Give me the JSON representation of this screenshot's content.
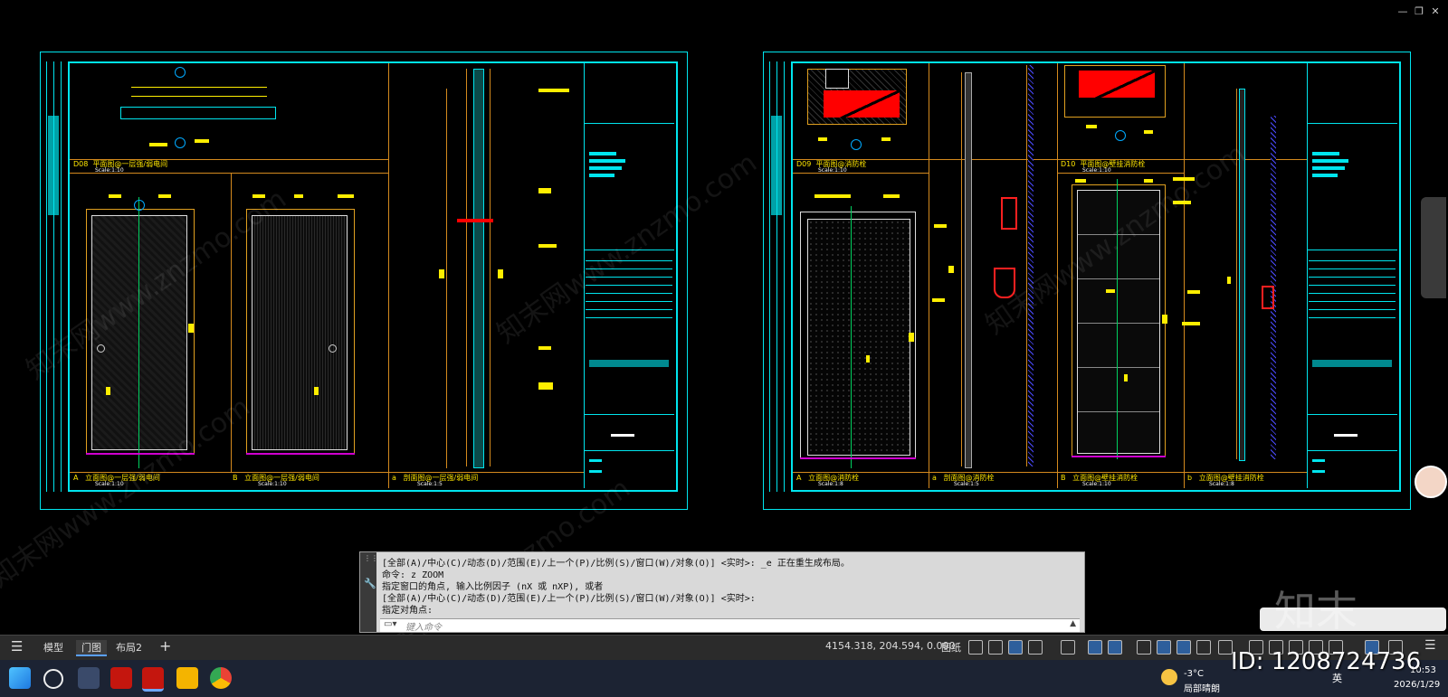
{
  "window": {
    "minimize_icon": "minimize-icon",
    "restore_icon": "restore-icon",
    "close_icon": "close-icon"
  },
  "sheet_left": {
    "views": [
      {
        "code": "D08",
        "title": "平面图@一层强/弱电间",
        "scale": "Scale:1:10"
      },
      {
        "code": "A",
        "title": "立面图@一层强/弱电间",
        "scale": "Scale:1:10"
      },
      {
        "code": "B",
        "title": "立面图@一层强/弱电间",
        "scale": "Scale:1:10"
      },
      {
        "code": "a",
        "title": "剖面图@一层强/弱电间",
        "scale": "Scale:1:5"
      }
    ]
  },
  "sheet_right": {
    "views": [
      {
        "code": "D09",
        "title": "平面图@消防栓",
        "scale": "Scale:1:10"
      },
      {
        "code": "D10",
        "title": "平面图@壁挂消防栓",
        "scale": "Scale:1:10"
      },
      {
        "code": "A",
        "title": "立面图@消防栓",
        "scale": "Scale:1:8"
      },
      {
        "code": "a",
        "title": "剖面图@消防栓",
        "scale": "Scale:1:5"
      },
      {
        "code": "B",
        "title": "立面图@壁挂消防栓",
        "scale": "Scale:1:10"
      },
      {
        "code": "b",
        "title": "立面图@壁挂消防栓",
        "scale": "Scale:1:8"
      }
    ]
  },
  "command_window": {
    "lines": [
      "[全部(A)/中心(C)/动态(D)/范围(E)/上一个(P)/比例(S)/窗口(W)/对象(O)] <实时>: _e 正在重生成布局。",
      "命令: z ZOOM",
      "指定窗口的角点, 输入比例因子 (nX 或 nXP), 或者",
      "[全部(A)/中心(C)/动态(D)/范围(E)/上一个(P)/比例(S)/窗口(W)/对象(O)] <实时>:",
      "指定对角点:"
    ],
    "input_placeholder": "键入命令"
  },
  "layout_tabs": {
    "menu_icon": "hamburger-menu-icon",
    "tabs": [
      "模型",
      "门图",
      "布局2"
    ],
    "active": "门图",
    "add_icon": "plus-icon"
  },
  "status_bar": {
    "coordinates": "4154.318, 204.594, 0.000",
    "space": "图纸"
  },
  "taskbar": {
    "weather_temp": "-3°C",
    "weather_desc": "局部晴朗",
    "ime": "英",
    "time": "10:53",
    "date": "2026/1/29"
  },
  "watermark": {
    "text": "知末网www.znzmo.com",
    "logo": "知末",
    "id_label": "ID: 1208724736"
  },
  "colors": {
    "cyan": "#00e5ee",
    "orange": "#d48a1e",
    "yellow": "#ffee00",
    "red": "#ff0000",
    "bg": "#000000"
  }
}
